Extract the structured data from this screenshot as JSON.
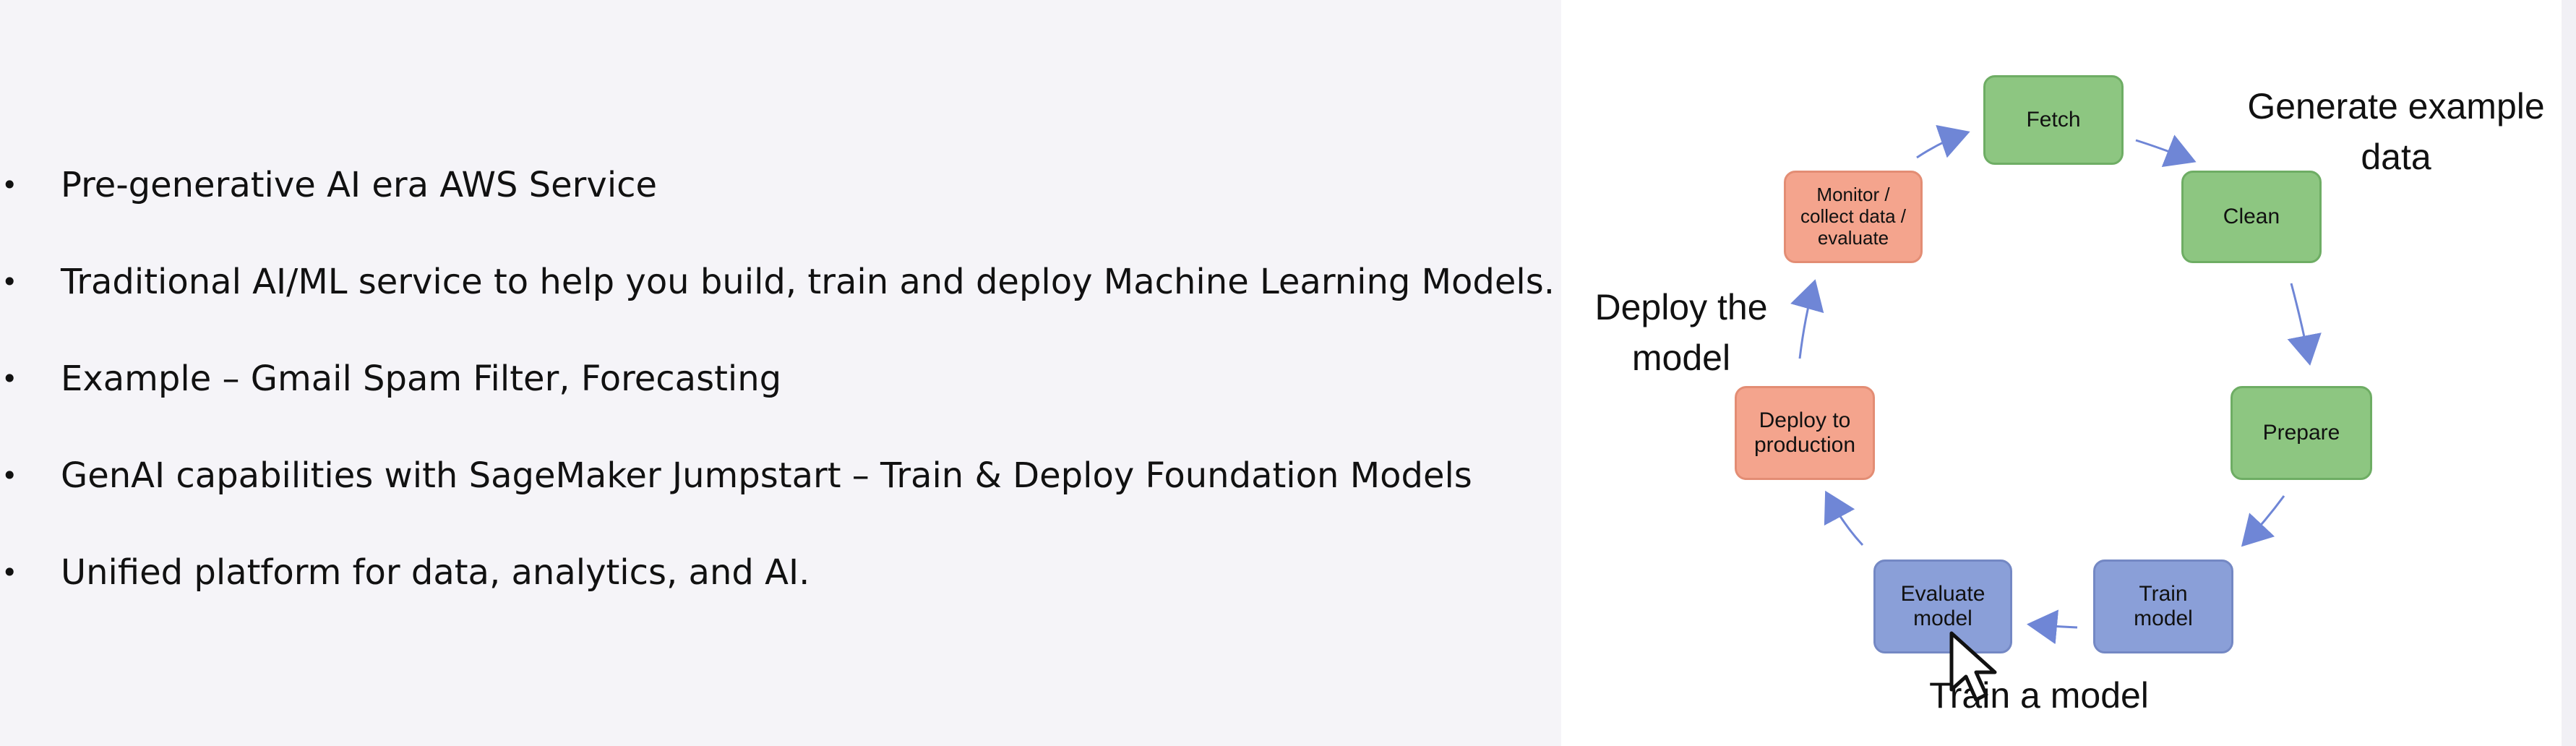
{
  "bullets": [
    "Pre-generative AI era AWS Service",
    "Traditional AI/ML service to help you build, train and deploy Machine Learning Models.",
    "Example – Gmail Spam Filter, Forecasting",
    "GenAI capabilities with SageMaker Jumpstart – Train & Deploy Foundation Models",
    "Unified platform for data, analytics, and AI."
  ],
  "diagram": {
    "nodes": {
      "fetch": "Fetch",
      "clean": "Clean",
      "prepare": "Prepare",
      "train_model": "Train\nmodel",
      "evaluate_model": "Evaluate\nmodel",
      "deploy_to_production": "Deploy to\nproduction",
      "monitor_collect_evaluate": "Monitor /\ncollect data /\nevaluate"
    },
    "annotations": {
      "generate_example_data": "Generate example\ndata",
      "deploy_the_model": "Deploy the\nmodel",
      "train_a_model": "Train a model"
    }
  },
  "colors": {
    "left_background": "#f5f4f8",
    "right_background": "#ffffff",
    "green": "#8dc681",
    "red": "#f4a48d",
    "blue": "#8a9fd8",
    "arrow": "#6f86d6"
  },
  "icons": {
    "cursor": "arrow-pointer-icon"
  }
}
